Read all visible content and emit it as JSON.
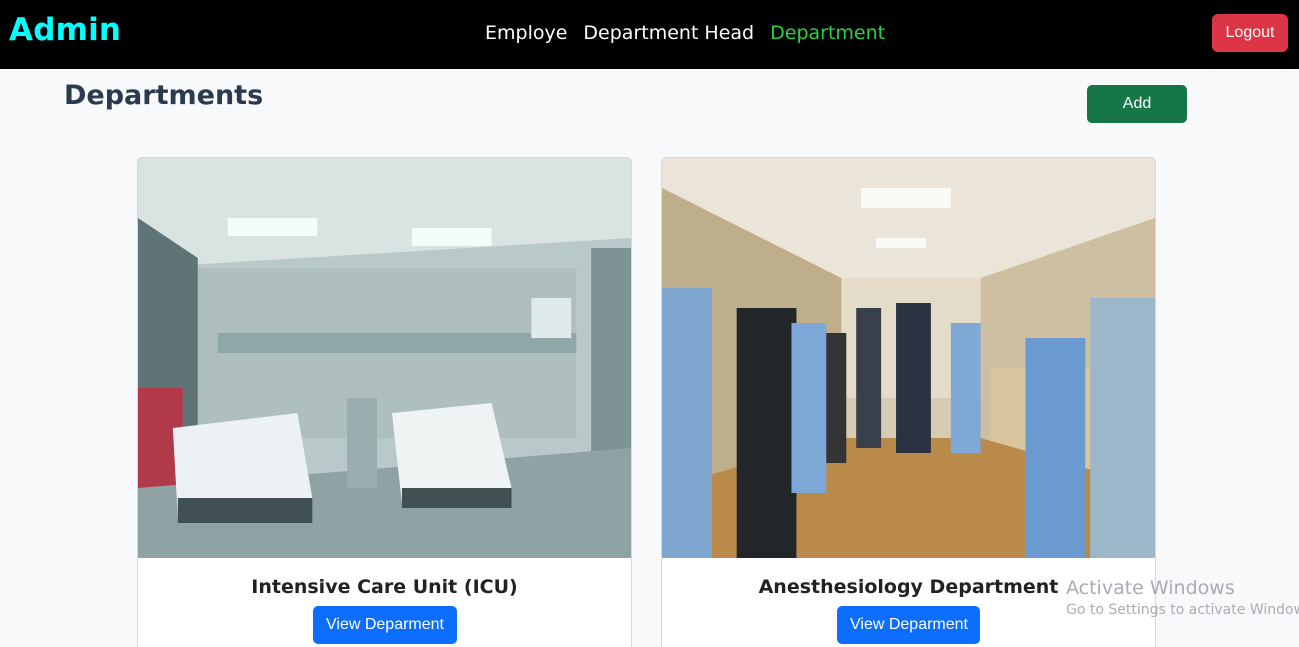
{
  "navbar": {
    "brand": "Admin",
    "links": [
      {
        "label": "Employe",
        "active": false
      },
      {
        "label": "Department Head",
        "active": false
      },
      {
        "label": "Department",
        "active": true
      }
    ],
    "logout_label": "Logout",
    "accent_color": "#26d43e",
    "brand_color": "#00ffff"
  },
  "main": {
    "title": "Departments",
    "add_label": "Add"
  },
  "departments": [
    {
      "name": "Intensive Care Unit (ICU)",
      "button_label": "View Deparment",
      "image": "icu-room-photo"
    },
    {
      "name": "Anesthesiology Department",
      "button_label": "View Deparment",
      "image": "hospital-hallway-staff-photo"
    }
  ],
  "watermark": {
    "title": "Activate Windows",
    "subtitle": "Go to Settings to activate Windows."
  }
}
